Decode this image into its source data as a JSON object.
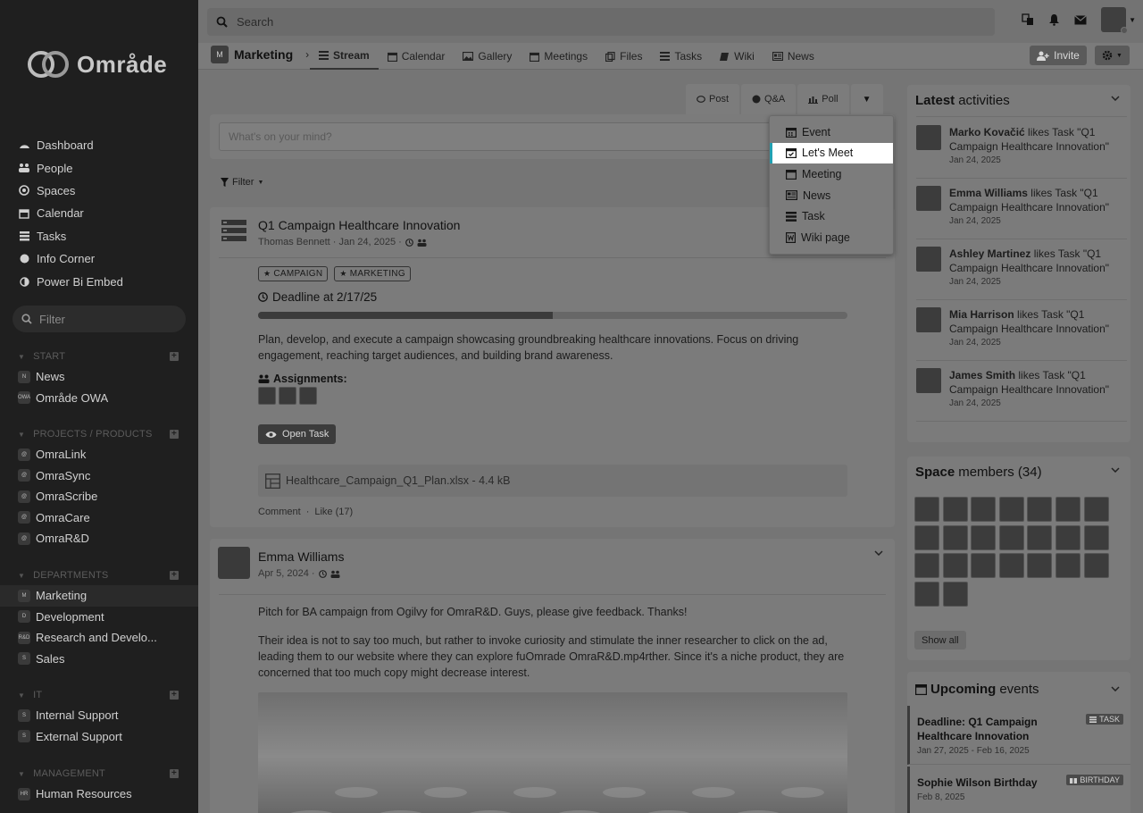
{
  "app": {
    "logo_text": "Område"
  },
  "sidebar": {
    "nav": [
      {
        "label": "Dashboard",
        "icon": "dashboard-icon"
      },
      {
        "label": "People",
        "icon": "users-icon"
      },
      {
        "label": "Spaces",
        "icon": "target-icon"
      },
      {
        "label": "Calendar",
        "icon": "calendar-icon"
      },
      {
        "label": "Tasks",
        "icon": "tasks-icon"
      },
      {
        "label": "Info Corner",
        "icon": "circle-icon"
      },
      {
        "label": "Power Bi Embed",
        "icon": "half-circle-icon"
      }
    ],
    "filter_placeholder": "Filter",
    "groups": [
      {
        "title": "START",
        "items": [
          {
            "abbr": "N",
            "label": "News"
          },
          {
            "abbr": "OWA",
            "label": "Område OWA"
          }
        ]
      },
      {
        "title": "PROJECTS / PRODUCTS",
        "items": [
          {
            "abbr": "@",
            "label": "OmraLink"
          },
          {
            "abbr": "@",
            "label": "OmraSync"
          },
          {
            "abbr": "@",
            "label": "OmraScribe"
          },
          {
            "abbr": "@",
            "label": "OmraCare"
          },
          {
            "abbr": "@",
            "label": "OmraR&D"
          }
        ]
      },
      {
        "title": "DEPARTMENTS",
        "items": [
          {
            "abbr": "M",
            "label": "Marketing"
          },
          {
            "abbr": "D",
            "label": "Development"
          },
          {
            "abbr": "R&D",
            "label": "Research and Develo..."
          },
          {
            "abbr": "S",
            "label": "Sales"
          }
        ]
      },
      {
        "title": "IT",
        "items": [
          {
            "abbr": "S",
            "label": "Internal Support"
          },
          {
            "abbr": "S",
            "label": "External Support"
          }
        ]
      },
      {
        "title": "MANAGEMENT",
        "items": [
          {
            "abbr": "HR",
            "label": "Human Resources"
          }
        ]
      }
    ]
  },
  "topbar": {
    "search_placeholder": "Search"
  },
  "space": {
    "abbr": "M",
    "name": "Marketing",
    "tabs": [
      {
        "label": "Stream",
        "icon": "stream-icon"
      },
      {
        "label": "Calendar",
        "icon": "calendar-icon"
      },
      {
        "label": "Gallery",
        "icon": "image-icon"
      },
      {
        "label": "Meetings",
        "icon": "calendar-check-icon"
      },
      {
        "label": "Files",
        "icon": "files-icon"
      },
      {
        "label": "Tasks",
        "icon": "tasks-icon"
      },
      {
        "label": "Wiki",
        "icon": "book-icon"
      },
      {
        "label": "News",
        "icon": "newspaper-icon"
      }
    ],
    "invite_label": "Invite"
  },
  "composer": {
    "tabs": [
      {
        "label": "Post",
        "icon": "comment-icon"
      },
      {
        "label": "Q&A",
        "icon": "question-icon"
      },
      {
        "label": "Poll",
        "icon": "bar-chart-icon"
      }
    ],
    "placeholder": "What's on your mind?",
    "filter_label": "Filter",
    "menu": [
      {
        "label": "Event",
        "icon": "calendar-icon"
      },
      {
        "label": "Let's Meet",
        "icon": "calendar-check-icon"
      },
      {
        "label": "Meeting",
        "icon": "calendar-blank-icon"
      },
      {
        "label": "News",
        "icon": "newspaper-icon"
      },
      {
        "label": "Task",
        "icon": "tasks-icon"
      },
      {
        "label": "Wiki page",
        "icon": "wiki-page-icon"
      }
    ]
  },
  "post1": {
    "title": "Q1 Campaign Healthcare Innovation",
    "meta": "Thomas Bennett · Jan 24, 2025 ·",
    "badges": [
      "CAMPAIGN",
      "MARKETING"
    ],
    "deadline": "Deadline at 2/17/25",
    "progress": 0.5,
    "description": "Plan, develop, and execute a campaign showcasing groundbreaking healthcare innovations. Focus on driving engagement, reaching target audiences, and building brand awareness.",
    "assignments_label": "Assignments:",
    "open_task_label": "Open Task",
    "file": "Healthcare_Campaign_Q1_Plan.xlsx - 4.4 kB",
    "comment_label": "Comment",
    "like_label": "Like (17)"
  },
  "post2": {
    "author": "Emma Williams",
    "meta": "Apr 5, 2024 ·",
    "text1": "Pitch for BA campaign from Ogilvy for OmraR&D. Guys, please give feedback. Thanks!",
    "text2": "Their idea is not to say too much, but rather to invoke curiosity and stimulate the inner researcher to click on the ad, leading them to our website where they can explore fuOmrade OmraR&D.mp4rther. Since it's a niche product, they are concerned that too much copy might decrease interest."
  },
  "latest": {
    "title_bold": "Latest",
    "title_rest": "activities",
    "items": [
      {
        "name": "Marko Kovačić",
        "text": "likes Task \"Q1 Campaign Healthcare Innovation\"",
        "date": "Jan 24, 2025"
      },
      {
        "name": "Emma Williams",
        "text": "likes Task \"Q1 Campaign Healthcare Innovation\"",
        "date": "Jan 24, 2025"
      },
      {
        "name": "Ashley Martinez",
        "text": "likes Task \"Q1 Campaign Healthcare Innovation\"",
        "date": "Jan 24, 2025"
      },
      {
        "name": "Mia Harrison",
        "text": "likes Task \"Q1 Campaign Healthcare Innovation\"",
        "date": "Jan 24, 2025"
      },
      {
        "name": "James Smith",
        "text": "likes Task \"Q1 Campaign Healthcare Innovation\"",
        "date": "Jan 24, 2025"
      }
    ]
  },
  "members": {
    "title_bold": "Space",
    "title_rest": "members (34)",
    "show_all": "Show all"
  },
  "upcoming": {
    "title_bold": "Upcoming",
    "title_rest": "events",
    "items": [
      {
        "title": "Deadline: Q1 Campaign Healthcare Innovation",
        "date": "Jan 27, 2025 - Feb 16, 2025",
        "tag": "TASK"
      },
      {
        "title": "Sophie Wilson Birthday",
        "date": "Feb 8, 2025",
        "tag": "BIRTHDAY"
      }
    ]
  },
  "colors": {
    "highlight_bar": "#21a1b3",
    "highlight_bg": "#ffffff"
  }
}
